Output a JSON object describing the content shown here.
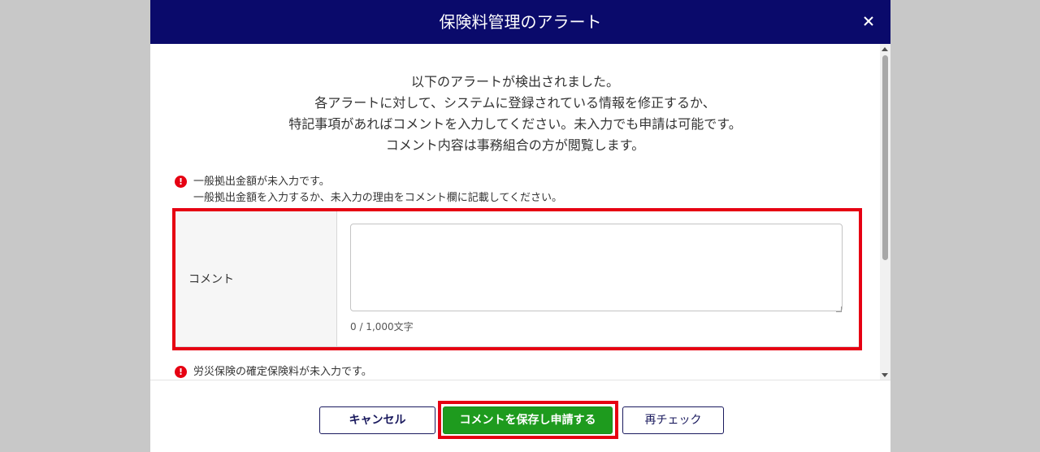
{
  "modal": {
    "title": "保険料管理のアラート",
    "close_icon": "close-icon"
  },
  "intro": {
    "lines": [
      "以下のアラートが検出されました。",
      "各アラートに対して、システムに登録されている情報を修正するか、",
      "特記事項があればコメントを入力してください。未入力でも申請は可能です。",
      "コメント内容は事務組合の方が閲覧します。"
    ]
  },
  "alerts": [
    {
      "icon": "!",
      "message": "一般拠出金額が未入力です。",
      "detail": "一般拠出金額を入力するか、未入力の理由をコメント欄に記載してください。",
      "comment_label": "コメント",
      "comment_value": "",
      "char_count": "0 / 1,000文字"
    },
    {
      "icon": "!",
      "message": "労災保険の確定保険料が未入力です。"
    }
  ],
  "footer": {
    "cancel_label": "キャンセル",
    "save_label": "コメントを保存し申請する",
    "recheck_label": "再チェック"
  },
  "colors": {
    "header_bg": "#0a0a6b",
    "alert_icon": "#e60012",
    "highlight": "#e60012",
    "save_button": "#1e9b1e"
  }
}
